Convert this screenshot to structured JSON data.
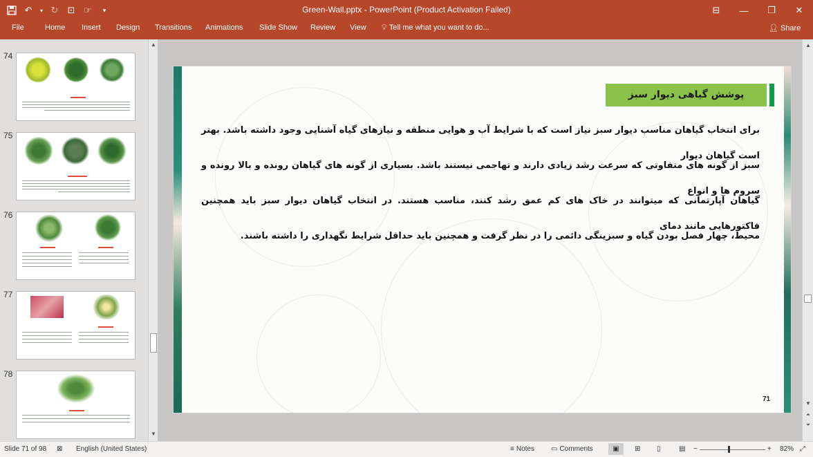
{
  "window": {
    "title": "Green-Wall.pptx - PowerPoint (Product Activation Failed)"
  },
  "ribbon": {
    "tabs": [
      "File",
      "Home",
      "Insert",
      "Design",
      "Transitions",
      "Animations",
      "Slide Show",
      "Review",
      "View"
    ],
    "tell_me": "Tell me what you want to do...",
    "share": "Share"
  },
  "thumbnails": [
    {
      "number": "74"
    },
    {
      "number": "75"
    },
    {
      "number": "76"
    },
    {
      "number": "77"
    },
    {
      "number": "78"
    }
  ],
  "slide": {
    "heading": "پوشش گیاهی دیوار سبز",
    "body_lines": [
      "برای انتخاب گیاهان مناسب دیوار سبز نیاز است که با شرایط آب و هوایی منطقه و نیازهای گیاه آشنایی وجود داشته باشد. بهتر است گیاهان دیوار",
      "سبز از گونه های متفاوتی که سرعت رشد زیادی دارند و تهاجمی نیستند باشد. بسیاری از گونه های گیاهان رونده و بالا رونده و سروم ها و انواع",
      "گیاهان آپارتمانی که میتوانند در خاک های کم عمق رشد کنند، مناسب هستند. در انتخاب گیاهان دیوار سبز باید همچنین فاکتورهایی مانند دمای",
      "محیط، چهار فصل بودن گیاه و سبزینگی دائمی را در نظر گرفت و همچنین باید حداقل شرایط نگهداری را داشته باشند."
    ],
    "page_number": "71"
  },
  "status": {
    "slide_info": "Slide 71 of 98",
    "language": "English (United States)",
    "notes": "Notes",
    "comments": "Comments",
    "zoom": "82%"
  },
  "colors": {
    "ribbon": "#b7472a",
    "heading_box": "#8bc34a",
    "heading_accent": "#0f9b47"
  }
}
